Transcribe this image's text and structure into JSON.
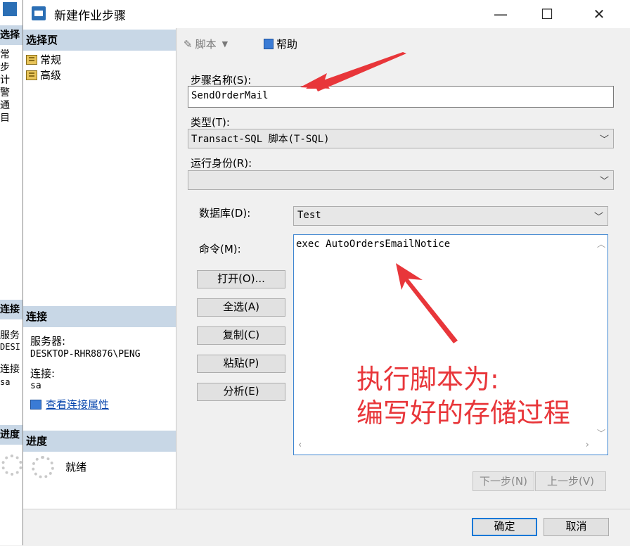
{
  "background_window": {
    "select_header": "选择",
    "items": [
      "常",
      "步",
      "计",
      "警",
      "通",
      "目"
    ],
    "connect_header": "连接",
    "server_label": "服务",
    "server_value": "DESI",
    "connection_label": "连接",
    "connection_value": "sa",
    "progress_header": "进度"
  },
  "dialog": {
    "title": "新建作业步骤",
    "window_controls": {
      "minimize": "—",
      "maximize": "☐",
      "close": "✕"
    }
  },
  "left_pane": {
    "select_page_header": "选择页",
    "pages": [
      {
        "label": "常规",
        "icon": "page-icon"
      },
      {
        "label": "高级",
        "icon": "page-icon"
      }
    ],
    "connection_header": "连接",
    "server_label": "服务器:",
    "server_value": "DESKTOP-RHR8876\\PENG",
    "connection_label": "连接:",
    "connection_value": "sa",
    "view_properties_link": "查看连接属性",
    "progress_header": "进度",
    "progress_status": "就绪"
  },
  "toolbar": {
    "script_label": "脚本",
    "help_label": "帮助"
  },
  "form": {
    "step_name_label": "步骤名称(S):",
    "step_name_value": "SendOrderMail",
    "type_label": "类型(T):",
    "type_value": "Transact-SQL 脚本(T-SQL)",
    "run_as_label": "运行身份(R):",
    "run_as_value": "",
    "database_label": "数据库(D):",
    "database_value": "Test",
    "command_label": "命令(M):",
    "command_value": "exec AutoOrdersEmailNotice"
  },
  "side_buttons": {
    "open": "打开(O)...",
    "select_all": "全选(A)",
    "copy": "复制(C)",
    "paste": "粘贴(P)",
    "parse": "分析(E)"
  },
  "annotation": {
    "line1": "执行脚本为:",
    "line2": "编写好的存储过程",
    "color": "#e8363a"
  },
  "nav_buttons": {
    "next": "下一步(N)",
    "previous": "上一步(V)"
  },
  "footer": {
    "ok": "确定",
    "cancel": "取消"
  }
}
